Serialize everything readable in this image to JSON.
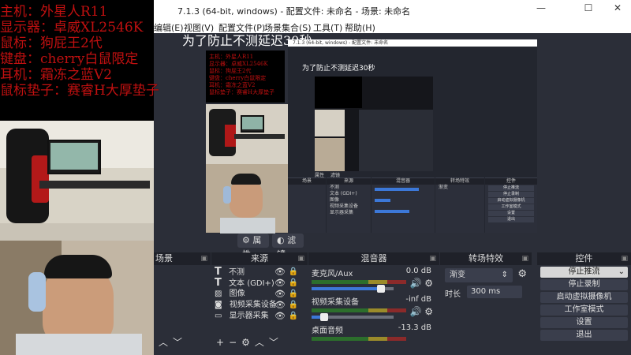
{
  "window": {
    "title": "7.1.3 (64-bit, windows) - 配置文件: 未命名 - 场景: 未命名",
    "controls": [
      "—",
      "☐",
      "✕"
    ]
  },
  "menubar": [
    "编辑(E)",
    "视图(V)",
    "配置文件(P)",
    "场景集合(S)",
    "工具(T)",
    "帮助(H)"
  ],
  "overlay": {
    "delay_notice": "为了防止不测延迟30秒"
  },
  "specs": [
    "主机：外星人R11",
    "显示器：卓威XL2546K",
    "鼠标：狗屁王2代",
    "键盘：cherry白鼠限定",
    "耳机：霜冻之蓝V2",
    "鼠标垫子：赛睿H大厚垫子"
  ],
  "source_toolbar": {
    "properties": "属性",
    "filters": "滤镜"
  },
  "scenes_dock": {
    "header": "场景"
  },
  "sources_dock": {
    "header": "来源",
    "items": [
      {
        "name": "不测",
        "icon": "text-icon"
      },
      {
        "name": "文本 (GDI+)",
        "icon": "text-icon"
      },
      {
        "name": "图像",
        "icon": "image-icon"
      },
      {
        "name": "视频采集设备",
        "icon": "camera-icon"
      },
      {
        "name": "显示器采集",
        "icon": "monitor-icon"
      }
    ]
  },
  "mixer_dock": {
    "header": "混音器",
    "channels": [
      {
        "name": "麦克风/Aux",
        "db": "0.0 dB",
        "level": 0.85
      },
      {
        "name": "视频采集设备",
        "db": "-inf dB",
        "level": 0.15
      },
      {
        "name": "桌面音频",
        "db": "-13.3 dB",
        "level": 0.7
      }
    ]
  },
  "transitions_dock": {
    "header": "转场特效",
    "selected": "渐变",
    "duration_label": "时长",
    "duration_value": "300 ms"
  },
  "controls_dock": {
    "header": "控件",
    "stream": "停止推流",
    "record": "停止录制",
    "virtual_cam": "启动虚拟摄像机",
    "studio": "工作室模式",
    "settings": "设置",
    "exit": "退出"
  },
  "nested": {
    "title": "7.1.3 (64-bit, windows) - 配置文件: 未命名",
    "delay_notice": "为了防止不测延迟30秒",
    "docks": [
      "场景",
      "来源",
      "混音器",
      "转场特效",
      "控件"
    ],
    "sources": [
      "不测",
      "文本 (GDI+)",
      "图像",
      "视频采集设备",
      "显示器采集"
    ],
    "controls": [
      "停止推流",
      "停止录制",
      "启动虚拟摄像机",
      "工作室模式",
      "设置",
      "退出"
    ],
    "transition": "渐变",
    "source_toolbar": [
      "属性",
      "滤镜"
    ]
  }
}
